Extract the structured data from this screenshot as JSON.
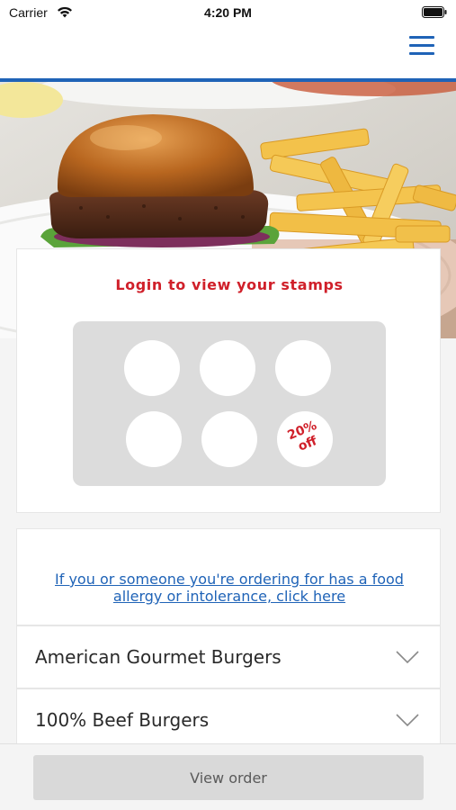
{
  "status_bar": {
    "carrier": "Carrier",
    "time": "4:20 PM",
    "wifi_icon": "wifi-icon",
    "battery_icon": "battery-icon"
  },
  "header": {
    "menu_icon": "hamburger-menu-icon",
    "accent_color": "#1f63b7"
  },
  "hero": {
    "image": "burger-and-fries-photo"
  },
  "stamps": {
    "title": "Login to view your stamps",
    "title_color": "#d0202a",
    "slots": [
      {
        "filled": false,
        "label": ""
      },
      {
        "filled": false,
        "label": ""
      },
      {
        "filled": false,
        "label": ""
      },
      {
        "filled": false,
        "label": ""
      },
      {
        "filled": false,
        "label": ""
      },
      {
        "filled": false,
        "label": "20%\noff"
      }
    ]
  },
  "allergy": {
    "link_text": "If you or someone you're ordering for has a food allergy or intolerance, click here"
  },
  "menu_categories": [
    {
      "label": "American Gourmet Burgers",
      "icon": "chevron-down-icon"
    },
    {
      "label": "100% Beef Burgers",
      "icon": "chevron-down-icon"
    }
  ],
  "footer": {
    "view_order_label": "View order"
  }
}
